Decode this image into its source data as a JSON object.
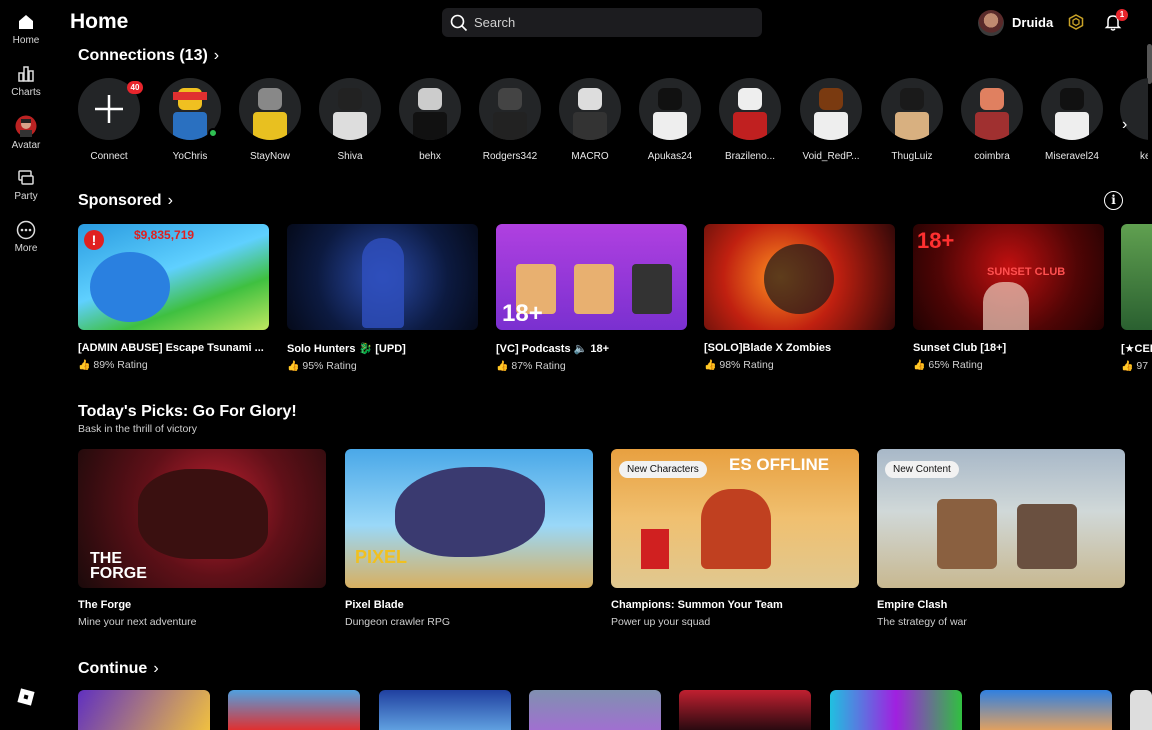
{
  "sidebar": {
    "items": [
      {
        "label": "Home",
        "icon": "home-icon"
      },
      {
        "label": "Charts",
        "icon": "charts-icon"
      },
      {
        "label": "Avatar",
        "icon": "avatar-icon"
      },
      {
        "label": "Party",
        "icon": "party-icon"
      },
      {
        "label": "More",
        "icon": "more-icon"
      }
    ]
  },
  "header": {
    "title": "Home",
    "search_placeholder": "Search",
    "username": "Druida",
    "notification_count": "1"
  },
  "connections": {
    "title": "Connections (13)",
    "add_label": "Connect",
    "add_badge": "40",
    "items": [
      "YoChris",
      "StayNow",
      "Shiva",
      "behx",
      "Rodgers342",
      "MACRO",
      "Apukas24",
      "Brazileno...",
      "Void_RedP...",
      "ThugLuiz",
      "coimbra",
      "Miseravel24",
      "ke"
    ]
  },
  "sponsored": {
    "title": "Sponsored",
    "games": [
      {
        "title": "[ADMIN ABUSE] Escape Tsunami ...",
        "rating": "89% Rating",
        "overlay": "$9,835,719"
      },
      {
        "title": "Solo Hunters 🐉 [UPD]",
        "rating": "95% Rating"
      },
      {
        "title": "[VC] Podcasts 🔈 18+",
        "rating": "87% Rating",
        "overlay": "18+"
      },
      {
        "title": "[SOLO]Blade X Zombies",
        "rating": "98% Rating"
      },
      {
        "title": "Sunset Club [18+]",
        "rating": "65% Rating",
        "overlay": "18+",
        "overlay2": "SUNSET CLUB"
      },
      {
        "title": "[★CEI",
        "rating": "97"
      }
    ]
  },
  "picks": {
    "title": "Today's Picks: Go For Glory!",
    "subtitle": "Bask in the thrill of victory",
    "games": [
      {
        "title": "The Forge",
        "sub": "Mine your next adventure",
        "overlay": "THE FORGE"
      },
      {
        "title": "Pixel Blade",
        "sub": "Dungeon crawler RPG",
        "overlay": "PIXEL"
      },
      {
        "title": "Champions: Summon Your Team",
        "sub": "Power up your squad",
        "pill": "New Characters",
        "overlay": "ES OFFLINE"
      },
      {
        "title": "Empire Clash",
        "sub": "The strategy of war",
        "pill": "New Content"
      }
    ]
  },
  "continue": {
    "title": "Continue"
  },
  "colors": {
    "background": "#000000",
    "card_bg": "#232527",
    "badge_red": "#e8252c",
    "online_green": "#2fbf52"
  }
}
